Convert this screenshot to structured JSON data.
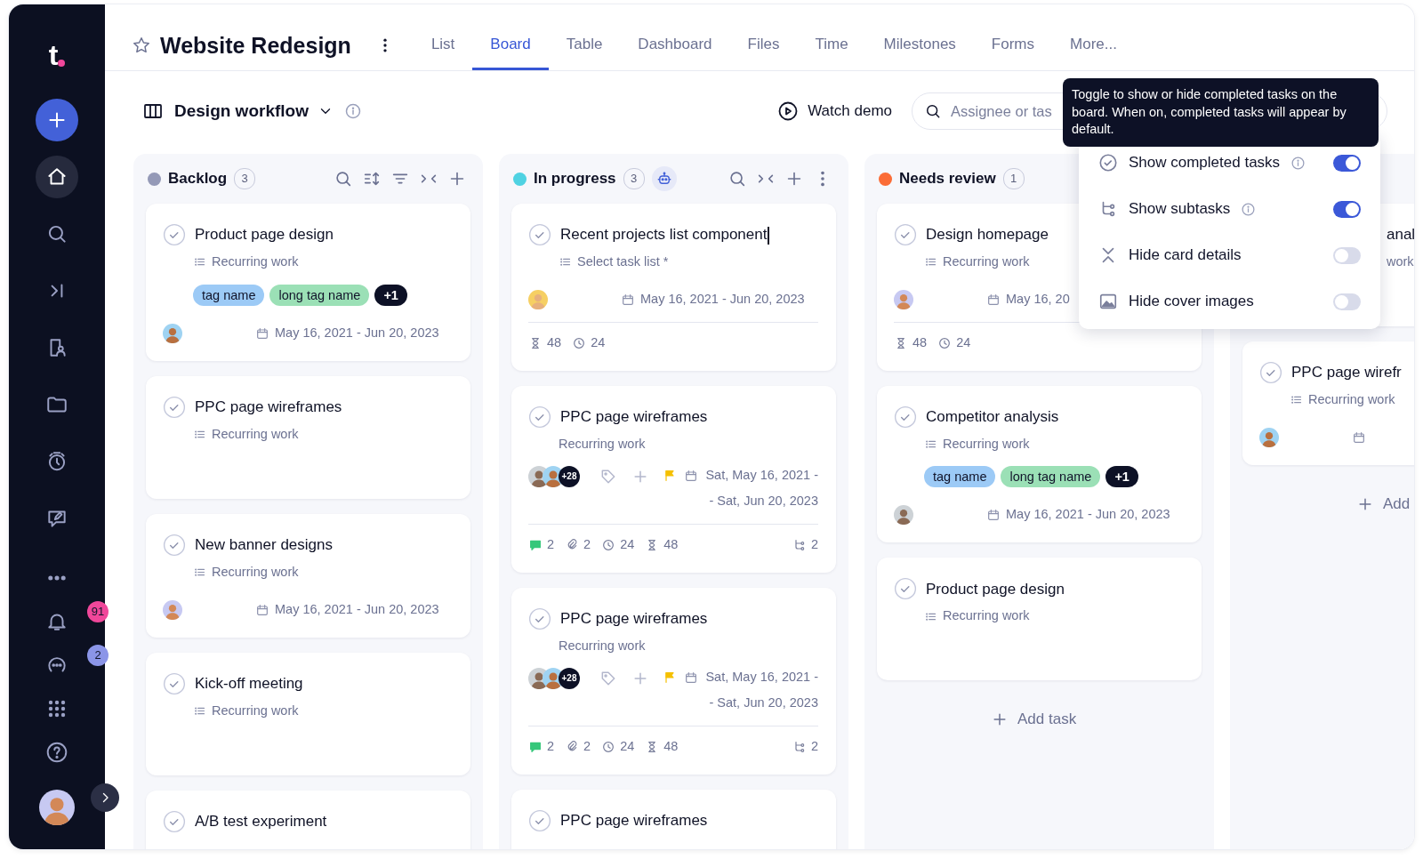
{
  "sidebar": {
    "logo": "t",
    "nav": [
      {
        "kind": "create",
        "selected": false
      },
      {
        "kind": "home",
        "selected": true
      },
      {
        "kind": "search",
        "selected": false
      },
      {
        "kind": "jump",
        "selected": false
      },
      {
        "kind": "people",
        "selected": false
      },
      {
        "kind": "folder",
        "selected": false
      },
      {
        "kind": "timer",
        "selected": false
      },
      {
        "kind": "feedback",
        "selected": false
      },
      {
        "kind": "more",
        "selected": false
      },
      {
        "kind": "notifications",
        "selected": false,
        "badge": "91"
      },
      {
        "kind": "chat",
        "selected": false,
        "badge": "2"
      },
      {
        "kind": "apps",
        "selected": false
      },
      {
        "kind": "help",
        "selected": false
      }
    ]
  },
  "header": {
    "title": "Website Redesign",
    "starred": false,
    "tabs": [
      {
        "label": "List",
        "selected": false
      },
      {
        "label": "Board",
        "selected": true
      },
      {
        "label": "Table",
        "selected": false
      },
      {
        "label": "Dashboard",
        "selected": false
      },
      {
        "label": "Files",
        "selected": false
      },
      {
        "label": "Time",
        "selected": false
      },
      {
        "label": "Milestones",
        "selected": false
      },
      {
        "label": "Forms",
        "selected": false
      },
      {
        "label": "More...",
        "selected": false
      }
    ]
  },
  "toolbar": {
    "board_name": "Design workflow",
    "demo_label": "Watch demo",
    "search": {
      "placeholder": "Assignee or tas"
    }
  },
  "tooltip": {
    "text": "Toggle to show or hide completed tasks on the board. When on, completed tasks will appear by default."
  },
  "view_menu": {
    "items": [
      {
        "kind": "completed",
        "label": "Show completed tasks",
        "info": true,
        "on": true
      },
      {
        "kind": "subtasks",
        "label": "Show subtasks",
        "info": true,
        "on": true
      },
      {
        "kind": "details",
        "label": "Hide card details",
        "info": false,
        "on": false
      },
      {
        "kind": "images",
        "label": "Hide cover images",
        "info": false,
        "on": false
      }
    ]
  },
  "columns": [
    {
      "kind": "sortable",
      "name": "Backlog",
      "color": "#9499b7",
      "count": "3",
      "cards": [
        {
          "kind": "basic",
          "title": "Product page design",
          "editing": false,
          "subtitle": "Recurring work",
          "list_icon": true,
          "tags": [
            {
              "label": "tag name",
              "color": "#9ccaf6"
            },
            {
              "label": "long tag name",
              "color": "#9be0b6"
            }
          ],
          "more_tags": "+1",
          "assignee": true,
          "date": "May 16, 2021 - Jun 20, 2023"
        },
        {
          "kind": "basic",
          "title": "PPC page wireframes",
          "editing": false,
          "subtitle": "Recurring work",
          "list_icon": true,
          "assignee": false
        },
        {
          "kind": "basic",
          "title": "New banner designs",
          "editing": false,
          "subtitle": "Recurring work",
          "list_icon": true,
          "assignee": true,
          "date": "May 16, 2021 - Jun 20, 2023"
        },
        {
          "kind": "basic",
          "title": "Kick-off meeting",
          "editing": false,
          "subtitle": "Recurring work",
          "list_icon": true,
          "assignee": false
        },
        {
          "kind": "basic",
          "title": "A/B test experiment",
          "editing": false,
          "assignee": false
        }
      ]
    },
    {
      "kind": "automated",
      "name": "In progress",
      "color": "#4fd2e2",
      "count": "3",
      "cards": [
        {
          "kind": "basic",
          "title": "Recent projects list component",
          "editing": true,
          "subtitle": "Select task list *",
          "list_icon": true,
          "assignee": true,
          "date": "May 16, 2021 - Jun 20, 2023",
          "stats": [
            {
              "kind": "estimate",
              "value": "48"
            },
            {
              "kind": "tracked",
              "value": "24"
            }
          ]
        },
        {
          "kind": "detailed",
          "title": "PPC page wireframes",
          "editing": false,
          "subtitle": "Recurring work",
          "list_icon": false,
          "assignee": true,
          "assignees_more": "+28",
          "flagged": true,
          "date_lines": [
            "Sat, May 16, 2021 -",
            "- Sat, Jun 20, 2023"
          ],
          "stats": [
            {
              "kind": "comments",
              "value": "2"
            },
            {
              "kind": "attachments",
              "value": "2"
            },
            {
              "kind": "tracked",
              "value": "24"
            },
            {
              "kind": "estimate",
              "value": "48"
            }
          ],
          "subtasks": "2"
        },
        {
          "kind": "detailed",
          "title": "PPC page wireframes",
          "editing": false,
          "subtitle": "Recurring work",
          "list_icon": false,
          "assignee": true,
          "assignees_more": "+28",
          "flagged": true,
          "date_lines": [
            "Sat, May 16, 2021 -",
            "- Sat, Jun 20, 2023"
          ],
          "stats": [
            {
              "kind": "comments",
              "value": "2"
            },
            {
              "kind": "attachments",
              "value": "2"
            },
            {
              "kind": "tracked",
              "value": "24"
            },
            {
              "kind": "estimate",
              "value": "48"
            }
          ],
          "subtasks": "2"
        },
        {
          "kind": "basic",
          "title": "PPC page wireframes",
          "editing": false,
          "assignee": false
        }
      ]
    },
    {
      "kind": "covered",
      "name": "Needs review",
      "color": "#fb6c36",
      "count": "1",
      "add_label": "Add task",
      "cards": [
        {
          "kind": "basic",
          "title": "Design homepage",
          "editing": false,
          "subtitle": "Recurring work",
          "list_icon": true,
          "assignee": true,
          "date": "May 16, 20",
          "stats": [
            {
              "kind": "estimate",
              "value": "48"
            },
            {
              "kind": "tracked",
              "value": "24"
            }
          ]
        },
        {
          "kind": "basic",
          "title": "Competitor analysis",
          "editing": false,
          "subtitle": "Recurring work",
          "list_icon": true,
          "tags": [
            {
              "label": "tag name",
              "color": "#9ccaf6"
            },
            {
              "label": "long tag name",
              "color": "#9be0b6"
            }
          ],
          "more_tags": "+1",
          "assignee": true,
          "date": "May 16, 2021 - Jun 20, 2023"
        },
        {
          "kind": "basic",
          "title": "Product page design",
          "editing": false,
          "subtitle": "Recurring work",
          "list_icon": true,
          "assignee": false
        }
      ]
    },
    {
      "kind": "hidden",
      "add_label": "Add",
      "cards": [
        {
          "kind": "partial",
          "title": "anal",
          "editing": false,
          "subtitle": "work",
          "assignee": false
        },
        {
          "kind": "basic",
          "title": "PPC page wirefr",
          "editing": false,
          "subtitle": "Recurring work",
          "list_icon": true,
          "assignee": true
        }
      ]
    }
  ]
}
